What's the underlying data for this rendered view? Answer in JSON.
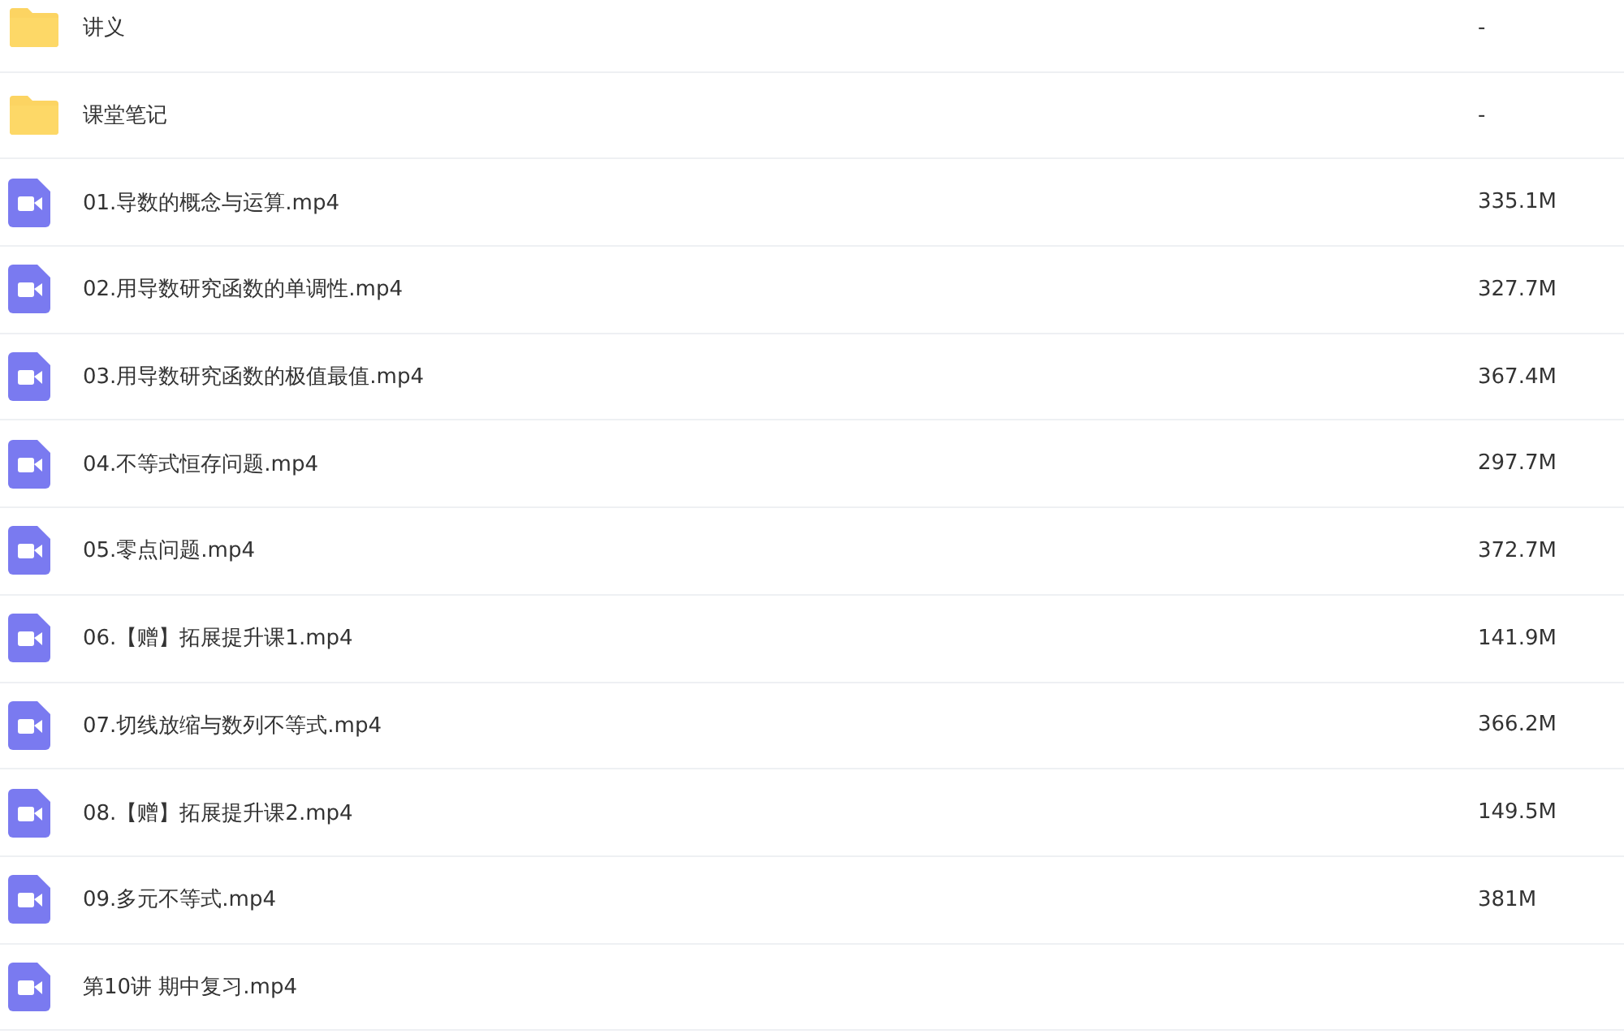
{
  "files": [
    {
      "kind": "folder",
      "name": "讲义",
      "size": "-"
    },
    {
      "kind": "folder",
      "name": "课堂笔记",
      "size": "-"
    },
    {
      "kind": "video",
      "name": "01.导数的概念与运算.mp4",
      "size": "335.1M"
    },
    {
      "kind": "video",
      "name": "02.用导数研究函数的单调性.mp4",
      "size": "327.7M"
    },
    {
      "kind": "video",
      "name": "03.用导数研究函数的极值最值.mp4",
      "size": "367.4M"
    },
    {
      "kind": "video",
      "name": "04.不等式恒存问题.mp4",
      "size": "297.7M"
    },
    {
      "kind": "video",
      "name": "05.零点问题.mp4",
      "size": "372.7M"
    },
    {
      "kind": "video",
      "name": "06.【赠】拓展提升课1.mp4",
      "size": "141.9M"
    },
    {
      "kind": "video",
      "name": "07.切线放缩与数列不等式.mp4",
      "size": "366.2M"
    },
    {
      "kind": "video",
      "name": "08.【赠】拓展提升课2.mp4",
      "size": "149.5M"
    },
    {
      "kind": "video",
      "name": "09.多元不等式.mp4",
      "size": "381M"
    },
    {
      "kind": "video",
      "name": "第10讲 期中复习.mp4"
    }
  ]
}
